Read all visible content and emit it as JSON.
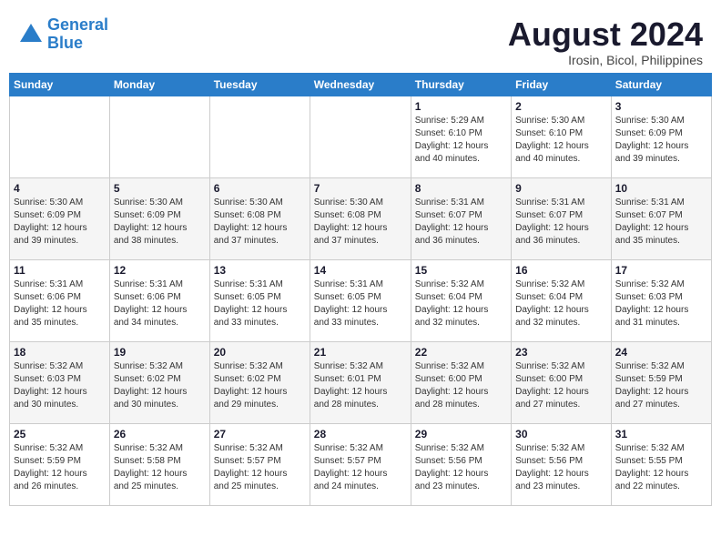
{
  "header": {
    "logo_line1": "General",
    "logo_line2": "Blue",
    "title": "August 2024",
    "subtitle": "Irosin, Bicol, Philippines"
  },
  "weekdays": [
    "Sunday",
    "Monday",
    "Tuesday",
    "Wednesday",
    "Thursday",
    "Friday",
    "Saturday"
  ],
  "weeks": [
    [
      {
        "day": "",
        "info": ""
      },
      {
        "day": "",
        "info": ""
      },
      {
        "day": "",
        "info": ""
      },
      {
        "day": "",
        "info": ""
      },
      {
        "day": "1",
        "info": "Sunrise: 5:29 AM\nSunset: 6:10 PM\nDaylight: 12 hours\nand 40 minutes."
      },
      {
        "day": "2",
        "info": "Sunrise: 5:30 AM\nSunset: 6:10 PM\nDaylight: 12 hours\nand 40 minutes."
      },
      {
        "day": "3",
        "info": "Sunrise: 5:30 AM\nSunset: 6:09 PM\nDaylight: 12 hours\nand 39 minutes."
      }
    ],
    [
      {
        "day": "4",
        "info": "Sunrise: 5:30 AM\nSunset: 6:09 PM\nDaylight: 12 hours\nand 39 minutes."
      },
      {
        "day": "5",
        "info": "Sunrise: 5:30 AM\nSunset: 6:09 PM\nDaylight: 12 hours\nand 38 minutes."
      },
      {
        "day": "6",
        "info": "Sunrise: 5:30 AM\nSunset: 6:08 PM\nDaylight: 12 hours\nand 37 minutes."
      },
      {
        "day": "7",
        "info": "Sunrise: 5:30 AM\nSunset: 6:08 PM\nDaylight: 12 hours\nand 37 minutes."
      },
      {
        "day": "8",
        "info": "Sunrise: 5:31 AM\nSunset: 6:07 PM\nDaylight: 12 hours\nand 36 minutes."
      },
      {
        "day": "9",
        "info": "Sunrise: 5:31 AM\nSunset: 6:07 PM\nDaylight: 12 hours\nand 36 minutes."
      },
      {
        "day": "10",
        "info": "Sunrise: 5:31 AM\nSunset: 6:07 PM\nDaylight: 12 hours\nand 35 minutes."
      }
    ],
    [
      {
        "day": "11",
        "info": "Sunrise: 5:31 AM\nSunset: 6:06 PM\nDaylight: 12 hours\nand 35 minutes."
      },
      {
        "day": "12",
        "info": "Sunrise: 5:31 AM\nSunset: 6:06 PM\nDaylight: 12 hours\nand 34 minutes."
      },
      {
        "day": "13",
        "info": "Sunrise: 5:31 AM\nSunset: 6:05 PM\nDaylight: 12 hours\nand 33 minutes."
      },
      {
        "day": "14",
        "info": "Sunrise: 5:31 AM\nSunset: 6:05 PM\nDaylight: 12 hours\nand 33 minutes."
      },
      {
        "day": "15",
        "info": "Sunrise: 5:32 AM\nSunset: 6:04 PM\nDaylight: 12 hours\nand 32 minutes."
      },
      {
        "day": "16",
        "info": "Sunrise: 5:32 AM\nSunset: 6:04 PM\nDaylight: 12 hours\nand 32 minutes."
      },
      {
        "day": "17",
        "info": "Sunrise: 5:32 AM\nSunset: 6:03 PM\nDaylight: 12 hours\nand 31 minutes."
      }
    ],
    [
      {
        "day": "18",
        "info": "Sunrise: 5:32 AM\nSunset: 6:03 PM\nDaylight: 12 hours\nand 30 minutes."
      },
      {
        "day": "19",
        "info": "Sunrise: 5:32 AM\nSunset: 6:02 PM\nDaylight: 12 hours\nand 30 minutes."
      },
      {
        "day": "20",
        "info": "Sunrise: 5:32 AM\nSunset: 6:02 PM\nDaylight: 12 hours\nand 29 minutes."
      },
      {
        "day": "21",
        "info": "Sunrise: 5:32 AM\nSunset: 6:01 PM\nDaylight: 12 hours\nand 28 minutes."
      },
      {
        "day": "22",
        "info": "Sunrise: 5:32 AM\nSunset: 6:00 PM\nDaylight: 12 hours\nand 28 minutes."
      },
      {
        "day": "23",
        "info": "Sunrise: 5:32 AM\nSunset: 6:00 PM\nDaylight: 12 hours\nand 27 minutes."
      },
      {
        "day": "24",
        "info": "Sunrise: 5:32 AM\nSunset: 5:59 PM\nDaylight: 12 hours\nand 27 minutes."
      }
    ],
    [
      {
        "day": "25",
        "info": "Sunrise: 5:32 AM\nSunset: 5:59 PM\nDaylight: 12 hours\nand 26 minutes."
      },
      {
        "day": "26",
        "info": "Sunrise: 5:32 AM\nSunset: 5:58 PM\nDaylight: 12 hours\nand 25 minutes."
      },
      {
        "day": "27",
        "info": "Sunrise: 5:32 AM\nSunset: 5:57 PM\nDaylight: 12 hours\nand 25 minutes."
      },
      {
        "day": "28",
        "info": "Sunrise: 5:32 AM\nSunset: 5:57 PM\nDaylight: 12 hours\nand 24 minutes."
      },
      {
        "day": "29",
        "info": "Sunrise: 5:32 AM\nSunset: 5:56 PM\nDaylight: 12 hours\nand 23 minutes."
      },
      {
        "day": "30",
        "info": "Sunrise: 5:32 AM\nSunset: 5:56 PM\nDaylight: 12 hours\nand 23 minutes."
      },
      {
        "day": "31",
        "info": "Sunrise: 5:32 AM\nSunset: 5:55 PM\nDaylight: 12 hours\nand 22 minutes."
      }
    ]
  ]
}
